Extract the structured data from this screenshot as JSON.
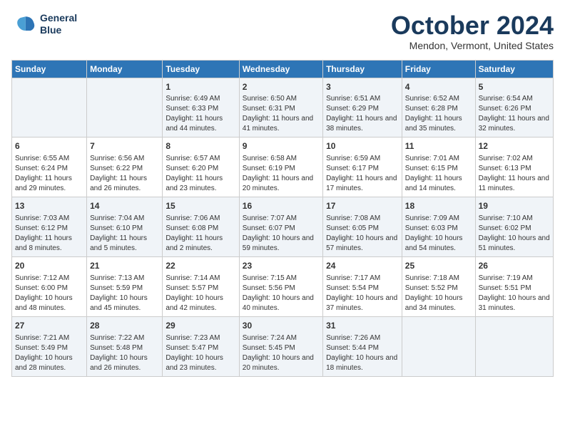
{
  "header": {
    "logo_line1": "General",
    "logo_line2": "Blue",
    "month": "October 2024",
    "location": "Mendon, Vermont, United States"
  },
  "weekdays": [
    "Sunday",
    "Monday",
    "Tuesday",
    "Wednesday",
    "Thursday",
    "Friday",
    "Saturday"
  ],
  "weeks": [
    [
      {
        "day": "",
        "info": ""
      },
      {
        "day": "",
        "info": ""
      },
      {
        "day": "1",
        "info": "Sunrise: 6:49 AM\nSunset: 6:33 PM\nDaylight: 11 hours and 44 minutes."
      },
      {
        "day": "2",
        "info": "Sunrise: 6:50 AM\nSunset: 6:31 PM\nDaylight: 11 hours and 41 minutes."
      },
      {
        "day": "3",
        "info": "Sunrise: 6:51 AM\nSunset: 6:29 PM\nDaylight: 11 hours and 38 minutes."
      },
      {
        "day": "4",
        "info": "Sunrise: 6:52 AM\nSunset: 6:28 PM\nDaylight: 11 hours and 35 minutes."
      },
      {
        "day": "5",
        "info": "Sunrise: 6:54 AM\nSunset: 6:26 PM\nDaylight: 11 hours and 32 minutes."
      }
    ],
    [
      {
        "day": "6",
        "info": "Sunrise: 6:55 AM\nSunset: 6:24 PM\nDaylight: 11 hours and 29 minutes."
      },
      {
        "day": "7",
        "info": "Sunrise: 6:56 AM\nSunset: 6:22 PM\nDaylight: 11 hours and 26 minutes."
      },
      {
        "day": "8",
        "info": "Sunrise: 6:57 AM\nSunset: 6:20 PM\nDaylight: 11 hours and 23 minutes."
      },
      {
        "day": "9",
        "info": "Sunrise: 6:58 AM\nSunset: 6:19 PM\nDaylight: 11 hours and 20 minutes."
      },
      {
        "day": "10",
        "info": "Sunrise: 6:59 AM\nSunset: 6:17 PM\nDaylight: 11 hours and 17 minutes."
      },
      {
        "day": "11",
        "info": "Sunrise: 7:01 AM\nSunset: 6:15 PM\nDaylight: 11 hours and 14 minutes."
      },
      {
        "day": "12",
        "info": "Sunrise: 7:02 AM\nSunset: 6:13 PM\nDaylight: 11 hours and 11 minutes."
      }
    ],
    [
      {
        "day": "13",
        "info": "Sunrise: 7:03 AM\nSunset: 6:12 PM\nDaylight: 11 hours and 8 minutes."
      },
      {
        "day": "14",
        "info": "Sunrise: 7:04 AM\nSunset: 6:10 PM\nDaylight: 11 hours and 5 minutes."
      },
      {
        "day": "15",
        "info": "Sunrise: 7:06 AM\nSunset: 6:08 PM\nDaylight: 11 hours and 2 minutes."
      },
      {
        "day": "16",
        "info": "Sunrise: 7:07 AM\nSunset: 6:07 PM\nDaylight: 10 hours and 59 minutes."
      },
      {
        "day": "17",
        "info": "Sunrise: 7:08 AM\nSunset: 6:05 PM\nDaylight: 10 hours and 57 minutes."
      },
      {
        "day": "18",
        "info": "Sunrise: 7:09 AM\nSunset: 6:03 PM\nDaylight: 10 hours and 54 minutes."
      },
      {
        "day": "19",
        "info": "Sunrise: 7:10 AM\nSunset: 6:02 PM\nDaylight: 10 hours and 51 minutes."
      }
    ],
    [
      {
        "day": "20",
        "info": "Sunrise: 7:12 AM\nSunset: 6:00 PM\nDaylight: 10 hours and 48 minutes."
      },
      {
        "day": "21",
        "info": "Sunrise: 7:13 AM\nSunset: 5:59 PM\nDaylight: 10 hours and 45 minutes."
      },
      {
        "day": "22",
        "info": "Sunrise: 7:14 AM\nSunset: 5:57 PM\nDaylight: 10 hours and 42 minutes."
      },
      {
        "day": "23",
        "info": "Sunrise: 7:15 AM\nSunset: 5:56 PM\nDaylight: 10 hours and 40 minutes."
      },
      {
        "day": "24",
        "info": "Sunrise: 7:17 AM\nSunset: 5:54 PM\nDaylight: 10 hours and 37 minutes."
      },
      {
        "day": "25",
        "info": "Sunrise: 7:18 AM\nSunset: 5:52 PM\nDaylight: 10 hours and 34 minutes."
      },
      {
        "day": "26",
        "info": "Sunrise: 7:19 AM\nSunset: 5:51 PM\nDaylight: 10 hours and 31 minutes."
      }
    ],
    [
      {
        "day": "27",
        "info": "Sunrise: 7:21 AM\nSunset: 5:49 PM\nDaylight: 10 hours and 28 minutes."
      },
      {
        "day": "28",
        "info": "Sunrise: 7:22 AM\nSunset: 5:48 PM\nDaylight: 10 hours and 26 minutes."
      },
      {
        "day": "29",
        "info": "Sunrise: 7:23 AM\nSunset: 5:47 PM\nDaylight: 10 hours and 23 minutes."
      },
      {
        "day": "30",
        "info": "Sunrise: 7:24 AM\nSunset: 5:45 PM\nDaylight: 10 hours and 20 minutes."
      },
      {
        "day": "31",
        "info": "Sunrise: 7:26 AM\nSunset: 5:44 PM\nDaylight: 10 hours and 18 minutes."
      },
      {
        "day": "",
        "info": ""
      },
      {
        "day": "",
        "info": ""
      }
    ]
  ]
}
